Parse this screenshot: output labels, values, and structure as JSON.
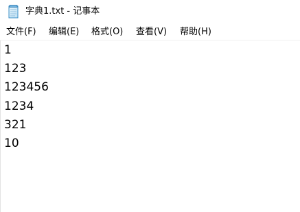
{
  "window": {
    "title": "字典1.txt - 记事本",
    "icon": "notepad-icon"
  },
  "menu": {
    "items": [
      {
        "label": "文件(F)"
      },
      {
        "label": "编辑(E)"
      },
      {
        "label": "格式(O)"
      },
      {
        "label": "查看(V)"
      },
      {
        "label": "帮助(H)"
      }
    ]
  },
  "editor": {
    "lines": [
      "1",
      "123",
      "123456",
      "1234",
      "321",
      "10"
    ]
  }
}
